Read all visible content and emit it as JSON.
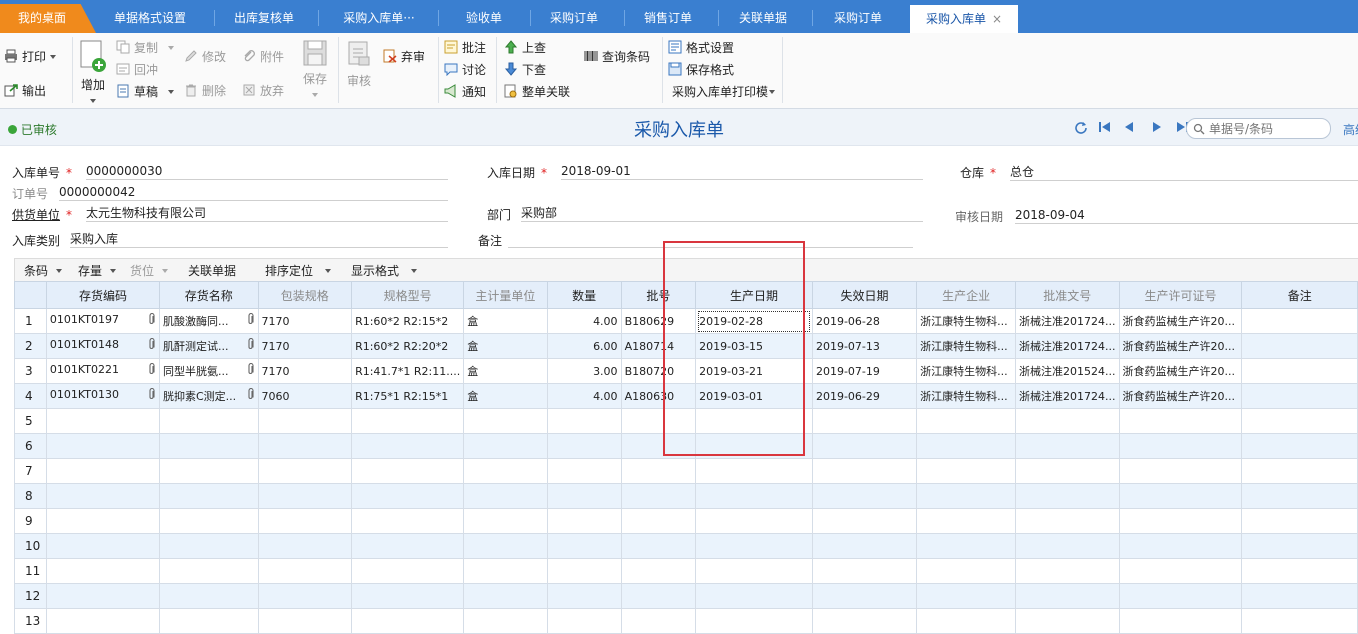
{
  "tabs": {
    "home": "我的桌面",
    "t1": "单据格式设置",
    "t2": "出库复核单",
    "t3": "采购入库单···",
    "t4": "验收单",
    "t5": "采购订单",
    "t6": "销售订单",
    "t7": "关联单据",
    "t8": "采购订单",
    "active": "采购入库单",
    "close": "×"
  },
  "toolbar": {
    "print": "打印",
    "export": "输出",
    "add": "增加",
    "copy": "复制",
    "reverse": "回冲",
    "draft": "草稿",
    "modify": "修改",
    "attach": "附件",
    "delete": "删除",
    "abandon_edit": "放弃",
    "save": "保存",
    "audit": "审核",
    "abandon_audit": "弃审",
    "annotate": "批注",
    "discuss": "讨论",
    "notify": "通知",
    "prev": "上查",
    "next": "下查",
    "relate": "整单关联",
    "barcode": "查询条码",
    "format_setting": "格式设置",
    "save_format": "保存格式",
    "print_template": "采购入库单打印模"
  },
  "status": {
    "audited": "已审核",
    "title": "采购入库单",
    "search_placeholder": "单据号/条码",
    "advanced": "高级"
  },
  "form": {
    "inbound_no_label": "入库单号",
    "inbound_no": "0000000030",
    "date_label": "入库日期",
    "date": "2018-09-01",
    "warehouse_label": "仓库",
    "warehouse": "总仓",
    "order_no_label": "订单号",
    "order_no": "0000000042",
    "supplier_label": "供货单位",
    "supplier": "太元生物科技有限公司",
    "dept_label": "部门",
    "dept": "采购部",
    "audit_date_label": "审核日期",
    "audit_date": "2018-09-04",
    "type_label": "入库类别",
    "type": "采购入库",
    "remark_label": "备注",
    "required_mark": "*"
  },
  "gridbar": {
    "barcode": "条码",
    "stock": "存量",
    "location": "货位",
    "related": "关联单据",
    "sort": "排序定位",
    "display": "显示格式"
  },
  "table": {
    "headers": [
      "",
      "存货编码",
      "存货名称",
      "包装规格",
      "规格型号",
      "主计量单位",
      "数量",
      "批号",
      "生产日期",
      "失效日期",
      "生产企业",
      "批准文号",
      "生产许可证号",
      "备注"
    ],
    "rows": [
      [
        "1",
        "0101KT0197",
        "肌酸激酶同...",
        "7170",
        "R1:60*2 R2:15*2",
        "盒",
        "4.00",
        "B180629",
        "2019-02-28",
        "2019-06-28",
        "浙江康特生物科...",
        "浙械注准201724...",
        "浙食药监械生产许20...",
        ""
      ],
      [
        "2",
        "0101KT0148",
        "肌酐测定试...",
        "7170",
        "R1:60*2 R2:20*2",
        "盒",
        "6.00",
        "A180714",
        "2019-03-15",
        "2019-07-13",
        "浙江康特生物科...",
        "浙械注准201724...",
        "浙食药监械生产许20...",
        ""
      ],
      [
        "3",
        "0101KT0221",
        "同型半胱氨...",
        "7170",
        "R1:41.7*1 R2:11....",
        "盒",
        "3.00",
        "B180720",
        "2019-03-21",
        "2019-07-19",
        "浙江康特生物科...",
        "浙械注准201524...",
        "浙食药监械生产许20...",
        ""
      ],
      [
        "4",
        "0101KT0130",
        "胱抑素C测定...",
        "7060",
        "R1:75*1 R2:15*1",
        "盒",
        "4.00",
        "A180630",
        "2019-03-01",
        "2019-06-29",
        "浙江康特生物科...",
        "浙械注准201724...",
        "浙食药监械生产许20...",
        ""
      ]
    ],
    "empty_rows": [
      "5",
      "6",
      "7",
      "8",
      "9",
      "10",
      "11",
      "12",
      "13"
    ]
  }
}
